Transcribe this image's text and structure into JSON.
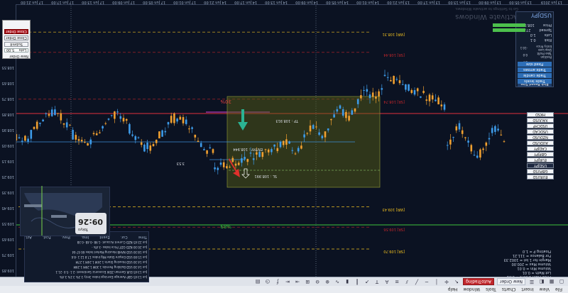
{
  "app": {
    "menu": [
      "File",
      "View",
      "Insert",
      "Charts",
      "Tools",
      "Window",
      "Help"
    ],
    "toolbar": {
      "new_order": "New Order",
      "auto_trading": "AutoTrading",
      "algo_label": "AutoTrading"
    }
  },
  "chart": {
    "symbol": "USDJPY",
    "period": "H1",
    "watermark": "Activate Windows",
    "watermark_sub": "Go to Settings to activate Windows.",
    "levels": [
      {
        "label": "[SR] 109.70",
        "color": "#f0c020",
        "y_price": 109.7
      },
      {
        "label": "[SR] 109.56",
        "color": "#c0262b",
        "y_price": 109.56
      },
      {
        "label": "[WR] 109.43",
        "color": "#f0c020",
        "y_price": 109.43
      },
      {
        "label": "[SR] 108.74",
        "color": "#c0262b",
        "y_price": 108.74
      },
      {
        "label": "[SR] 108.44",
        "color": "#c0262b",
        "y_price": 108.44
      },
      {
        "label": "[WR] 108.31",
        "color": "#f0c020",
        "y_price": 108.31
      }
    ],
    "percent_high": "30%",
    "percent_low": "%89",
    "tp_label": "TP : 108.913",
    "sl_label": "SL : 108.991",
    "entry_label": "ENTRY : 108.944",
    "mid_value": "3.53"
  },
  "symbols": [
    "EURUSD",
    "GBPUSD",
    "USDJPY",
    "EURJPY",
    "GBPJPY",
    "CADJPY",
    "AUDUSD",
    "NZDUSD",
    "USDCAD",
    "USDCHF",
    "XAUUSD",
    "HKSD"
  ],
  "trade_panel": {
    "title": "USDJPY",
    "rows": [
      {
        "label": "Price",
        "value": "108.972"
      },
      {
        "label": "Spread",
        "value": "27.0"
      },
      {
        "label": "Lots",
        "value": "1.0"
      },
      {
        "label": "Risk",
        "value": "0.1"
      }
    ],
    "buttons": [
      "Risk Based Size",
      "Fixed size",
      "Trade arrows",
      "Trade candle",
      "Trade levels"
    ],
    "small_stats": [
      "Entry Price",
      "Stop Loss",
      "Take Profit",
      "Position"
    ],
    "stat_values": [
      "-10.1",
      "0.0",
      "3.7"
    ]
  },
  "info_box": {
    "lines": [
      "Price Math 1.00% = 0.01",
      "Lot Math = 0.01",
      "Volume Min = 0.01",
      "Volume Max = 200.00",
      "Margin for 1 lot = 1002.33",
      "For Balance = 111.21",
      "Floating P = 1.0"
    ]
  },
  "order_dialog": {
    "title": "New Order",
    "field_label": "Lots",
    "field_value": "5.00",
    "submit": "Submit",
    "close": "Close Order",
    "close_all": "Close Order"
  },
  "clock": {
    "time": "09:26",
    "sub": "Tokyo"
  },
  "news": {
    "header": [
      "Time",
      "Cur.",
      "Event",
      "Imp.",
      "Prev.",
      "Fcst.",
      "Act."
    ],
    "rows": [
      "Jun 13:45  GBP  Average Earnings Index 3m/y   3.3%  3.1%  3.4%",
      "Jun 13:45  EUR  German ZEW Economic Sentiment   -2.1  -5.0  -21.1",
      "Jun 14:30  USD  Building Permits   1.30M  1.29M  1.29M",
      "Jun 14:30  USD  Housing Starts   1.24M  1.24M  1.27M",
      "Jun 15:00  USD  Empire State Mfg Index   17.8  12.1  -8.6",
      "Jun 18:30  USD  NAHB Housing Market Index   66  67  64",
      "Jun 20:30  NZD  GDT Price Index   -3.4%   -",
      "Jun 22:45  NZD  Current Account   -1.9B  -0.4B  -0.3B"
    ]
  },
  "price_axis": [
    "109.85",
    "109.75",
    "109.65",
    "109.55",
    "109.45",
    "109.35",
    "109.25",
    "109.15",
    "109.05",
    "108.95",
    "108.85",
    "108.75",
    "108.65",
    "108.55",
    "108.45",
    "108.35",
    "108.25"
  ],
  "time_axis": [
    "13 Jun 2019",
    "13 Jun 05:00",
    "13 Jun 09:00",
    "13 Jun 13:00",
    "13 Jun 17:00",
    "13 Jun 21:00",
    "14 Jun 01:00",
    "14 Jun 05:00",
    "14 Jun 09:00",
    "14 Jun 13:00",
    "14 Jun 17:00",
    "14 Jun 21:00",
    "17 Jun 01:00",
    "17 Jun 05:00",
    "17 Jun 09:00",
    "17 Jun 13:00",
    "17 Jun 17:00",
    "17 Jun 21:00"
  ]
}
